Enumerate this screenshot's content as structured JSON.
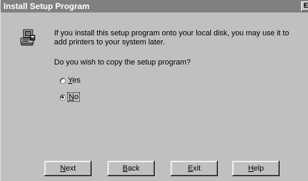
{
  "window": {
    "title": "Install Setup Program",
    "close_glyph": "E"
  },
  "content": {
    "icon": "printer-setup-icon",
    "message": "If you install this setup program onto your local disk, you may use it to\nadd printers to your system later.",
    "question": "Do you wish to copy the setup program?"
  },
  "options": {
    "yes": {
      "mnemonic": "Y",
      "rest": "es",
      "selected": false
    },
    "no": {
      "mnemonic": "N",
      "rest": "o",
      "selected": true
    }
  },
  "buttons": {
    "next": {
      "mnemonic": "N",
      "rest": "ext"
    },
    "back": {
      "mnemonic": "B",
      "rest": "ack"
    },
    "exit": {
      "mnemonic": "E",
      "rest": "xit"
    },
    "help": {
      "mnemonic": "H",
      "rest": "elp"
    }
  }
}
